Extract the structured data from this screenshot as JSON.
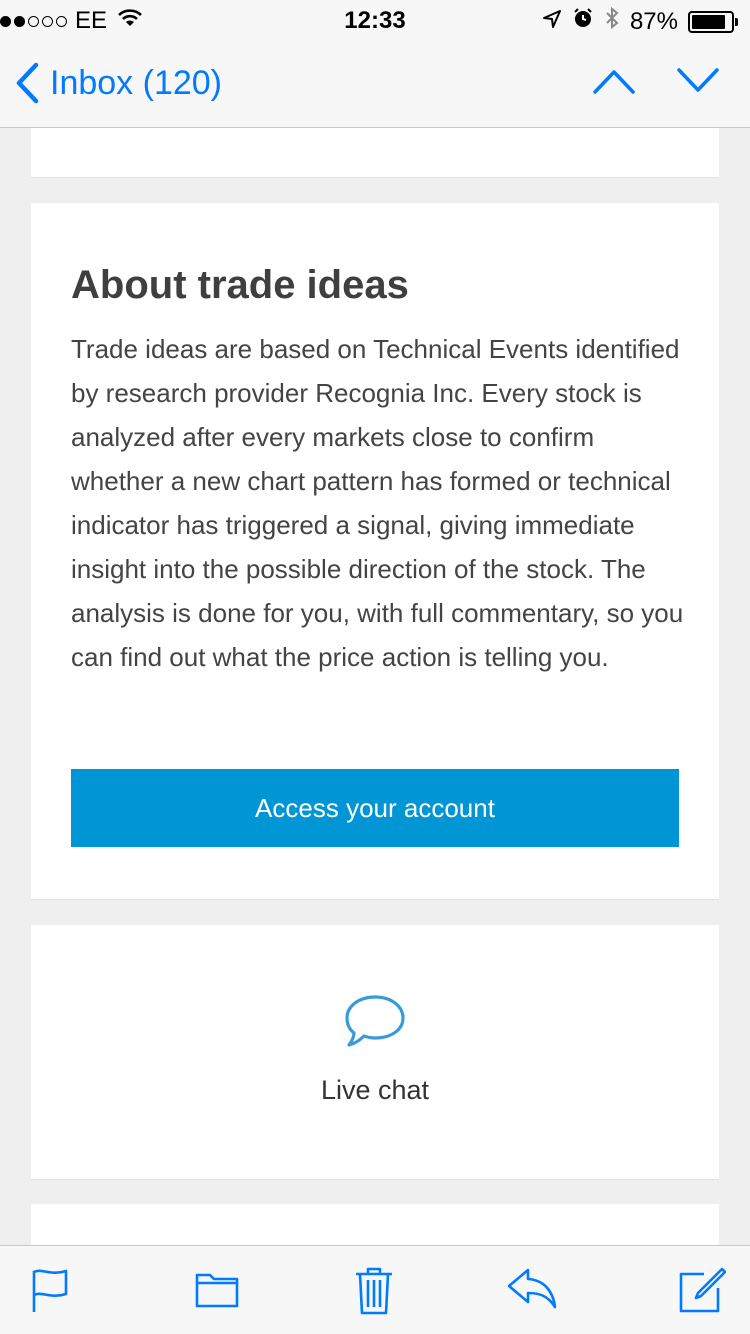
{
  "status_bar": {
    "carrier": "EE",
    "time": "12:33",
    "battery_percent": "87%",
    "battery_level": 0.87,
    "icons": [
      "signal-dots",
      "wifi-icon",
      "location-arrow-icon",
      "alarm-icon",
      "bluetooth-icon",
      "battery-icon"
    ]
  },
  "nav": {
    "back_label": "Inbox (120)",
    "icons": [
      "chevron-left-icon",
      "chevron-up-icon",
      "chevron-down-icon"
    ]
  },
  "about": {
    "title": "About trade ideas",
    "body": "Trade ideas are based on Technical Events identified by research provider Recognia Inc. Every stock is analyzed after every markets close to confirm whether a new chart pattern has formed or technical indicator has triggered a signal, giving immediate insight into the possible direction of the stock. The analysis is done for you, with full commentary, so you can find out what the price action is telling you.",
    "button_label": "Access your account"
  },
  "chat": {
    "label": "Live chat",
    "icon": "speech-bubble-icon"
  },
  "toolbar": {
    "icons": [
      "flag-icon",
      "folder-icon",
      "trash-icon",
      "reply-icon",
      "compose-icon"
    ]
  },
  "colors": {
    "ios_blue": "#007aff",
    "cta_blue": "#0096d6",
    "chat_icon": "#3a9ad9"
  }
}
